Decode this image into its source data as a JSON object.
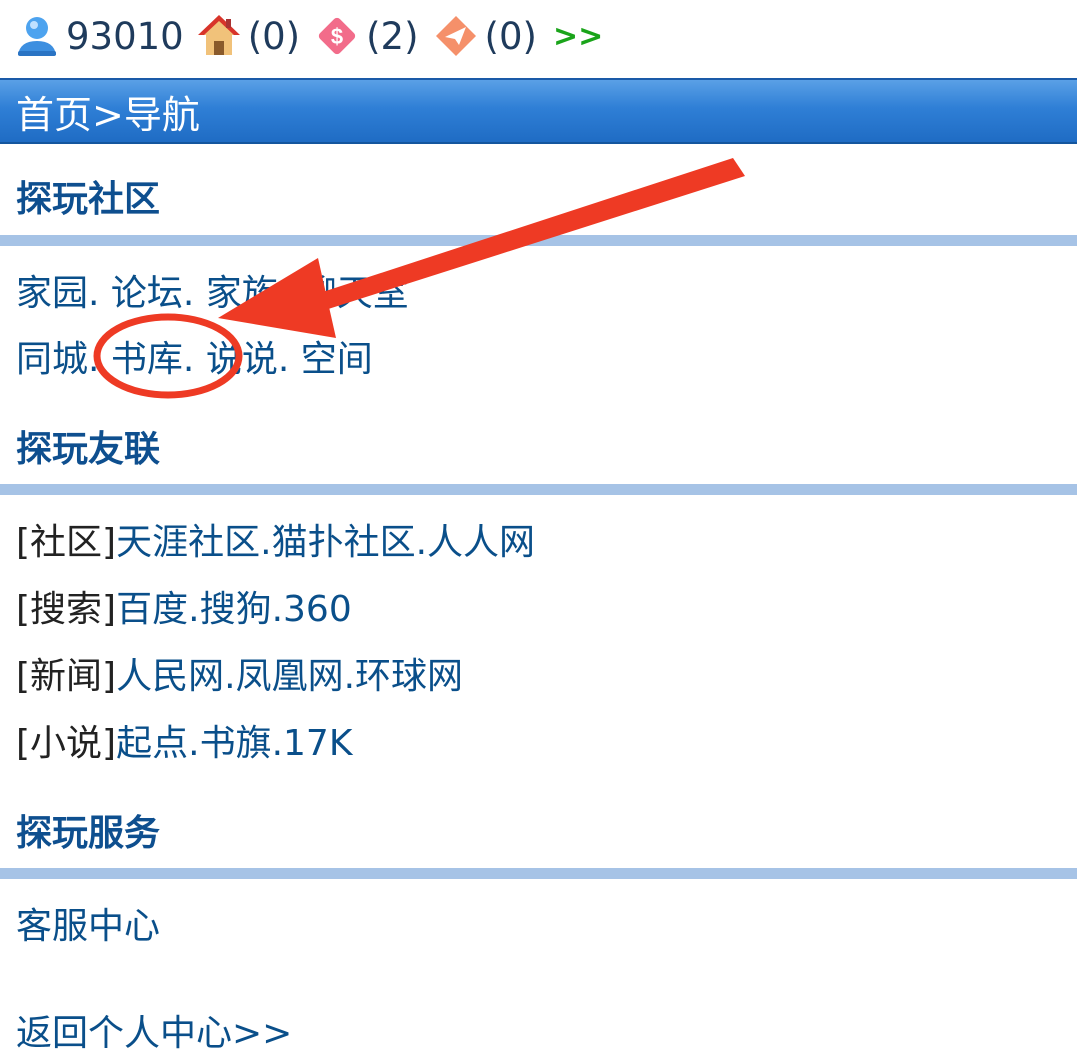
{
  "status": {
    "user_id": "93010",
    "home_count": "(0)",
    "money_count": "(2)",
    "msg_count": "(0)",
    "more": ">>"
  },
  "header": {
    "breadcrumb": "首页>导航"
  },
  "sections": {
    "community": {
      "title": "探玩社区",
      "row1": [
        "家园",
        "论坛",
        "家族",
        "聊天室"
      ],
      "row2": [
        "同城",
        "书库",
        "说说",
        "空间"
      ]
    },
    "friends": {
      "title": "探玩友联",
      "rows": [
        {
          "tag": "[社区]",
          "links": [
            "天涯社区",
            "猫扑社区",
            "人人网"
          ]
        },
        {
          "tag": "[搜索]",
          "links": [
            "百度",
            "搜狗",
            "360"
          ]
        },
        {
          "tag": "[新闻]",
          "links": [
            "人民网",
            "凤凰网",
            "环球网"
          ]
        },
        {
          "tag": "[小说]",
          "links": [
            "起点",
            "书旗",
            "17K"
          ]
        }
      ]
    },
    "service": {
      "title": "探玩服务",
      "items": [
        "客服中心"
      ]
    }
  },
  "footer": {
    "back_link": "返回个人中心>>"
  },
  "icons": {
    "user": "user-icon",
    "home": "house-icon",
    "money": "money-bag-icon",
    "message": "paper-plane-icon"
  },
  "colors": {
    "header_blue": "#2f7fd6",
    "link_blue": "#0a4f8a",
    "divider": "#a6c3e6",
    "annotation_red": "#ee3a24",
    "more_green": "#1aa41a"
  }
}
